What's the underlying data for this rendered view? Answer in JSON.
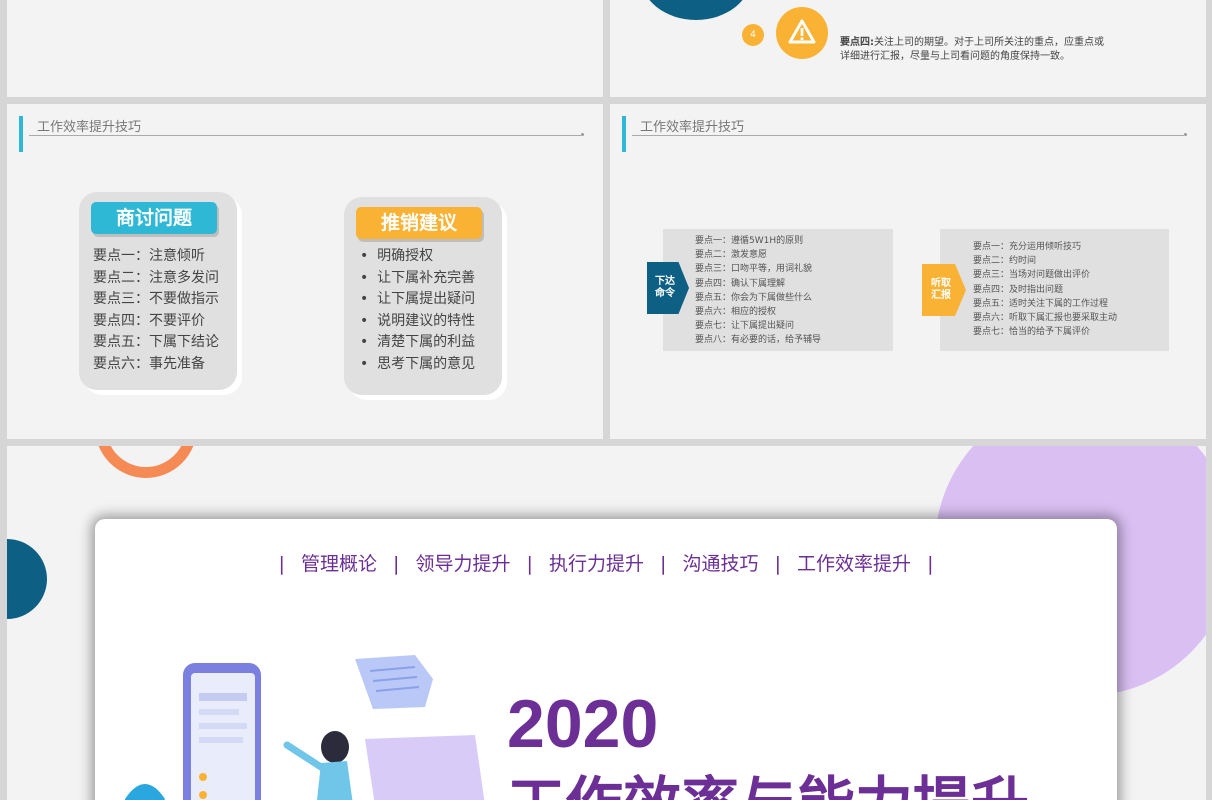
{
  "top_right": {
    "badge_number": "4",
    "point_label": "要点四:",
    "point_text_line1": "关注上司的期望。对于上司所关注的重点，应重点或",
    "point_text_line2": "详细进行汇报，尽量与上司看问题的角度保持一致。"
  },
  "mid_left": {
    "header": "工作效率提升技巧",
    "card1": {
      "title": "商讨问题",
      "items": [
        "要点一：注意倾听",
        "要点二：注意多发问",
        "要点三：不要做指示",
        "要点四：不要评价",
        "要点五：下属下结论",
        "要点六：事先准备"
      ]
    },
    "card2": {
      "title": "推销建议",
      "items": [
        "明确授权",
        "让下属补充完善",
        "让下属提出疑问",
        "说明建议的特性",
        "清楚下属的利益",
        "思考下属的意见"
      ]
    }
  },
  "mid_right": {
    "header": "工作效率提升技巧",
    "left_tag": "下达\n命令",
    "left_items": [
      "要点一：遵循5W1H的原则",
      "要点二：激发意愿",
      "要点三：口吻平等，用词礼貌",
      "要点四：确认下属理解",
      "要点五：你会为下属做些什么",
      "要点六：相应的授权",
      "要点七：让下属提出疑问",
      "要点八：有必要的话，给予辅导"
    ],
    "right_tag": "听取\n汇报",
    "right_items": [
      "要点一：充分运用倾听技巧",
      "要点二：约时间",
      "要点三：当场对问题做出评价",
      "要点四：及时指出问题",
      "要点五：适时关注下属的工作过程",
      "要点六：听取下属汇报也要采取主动",
      "要点七：恰当的给予下属评价"
    ]
  },
  "bottom": {
    "nav_items": [
      "管理概论",
      "领导力提升",
      "执行力提升",
      "沟通技巧",
      "工作效率提升"
    ],
    "nav_separator": "|",
    "year": "2020",
    "title": "工作效率与能力提升"
  },
  "colors": {
    "purple": "#6b2f96",
    "teal": "#2eb8d6",
    "orange": "#f9a825",
    "navy": "#0e5f84"
  }
}
